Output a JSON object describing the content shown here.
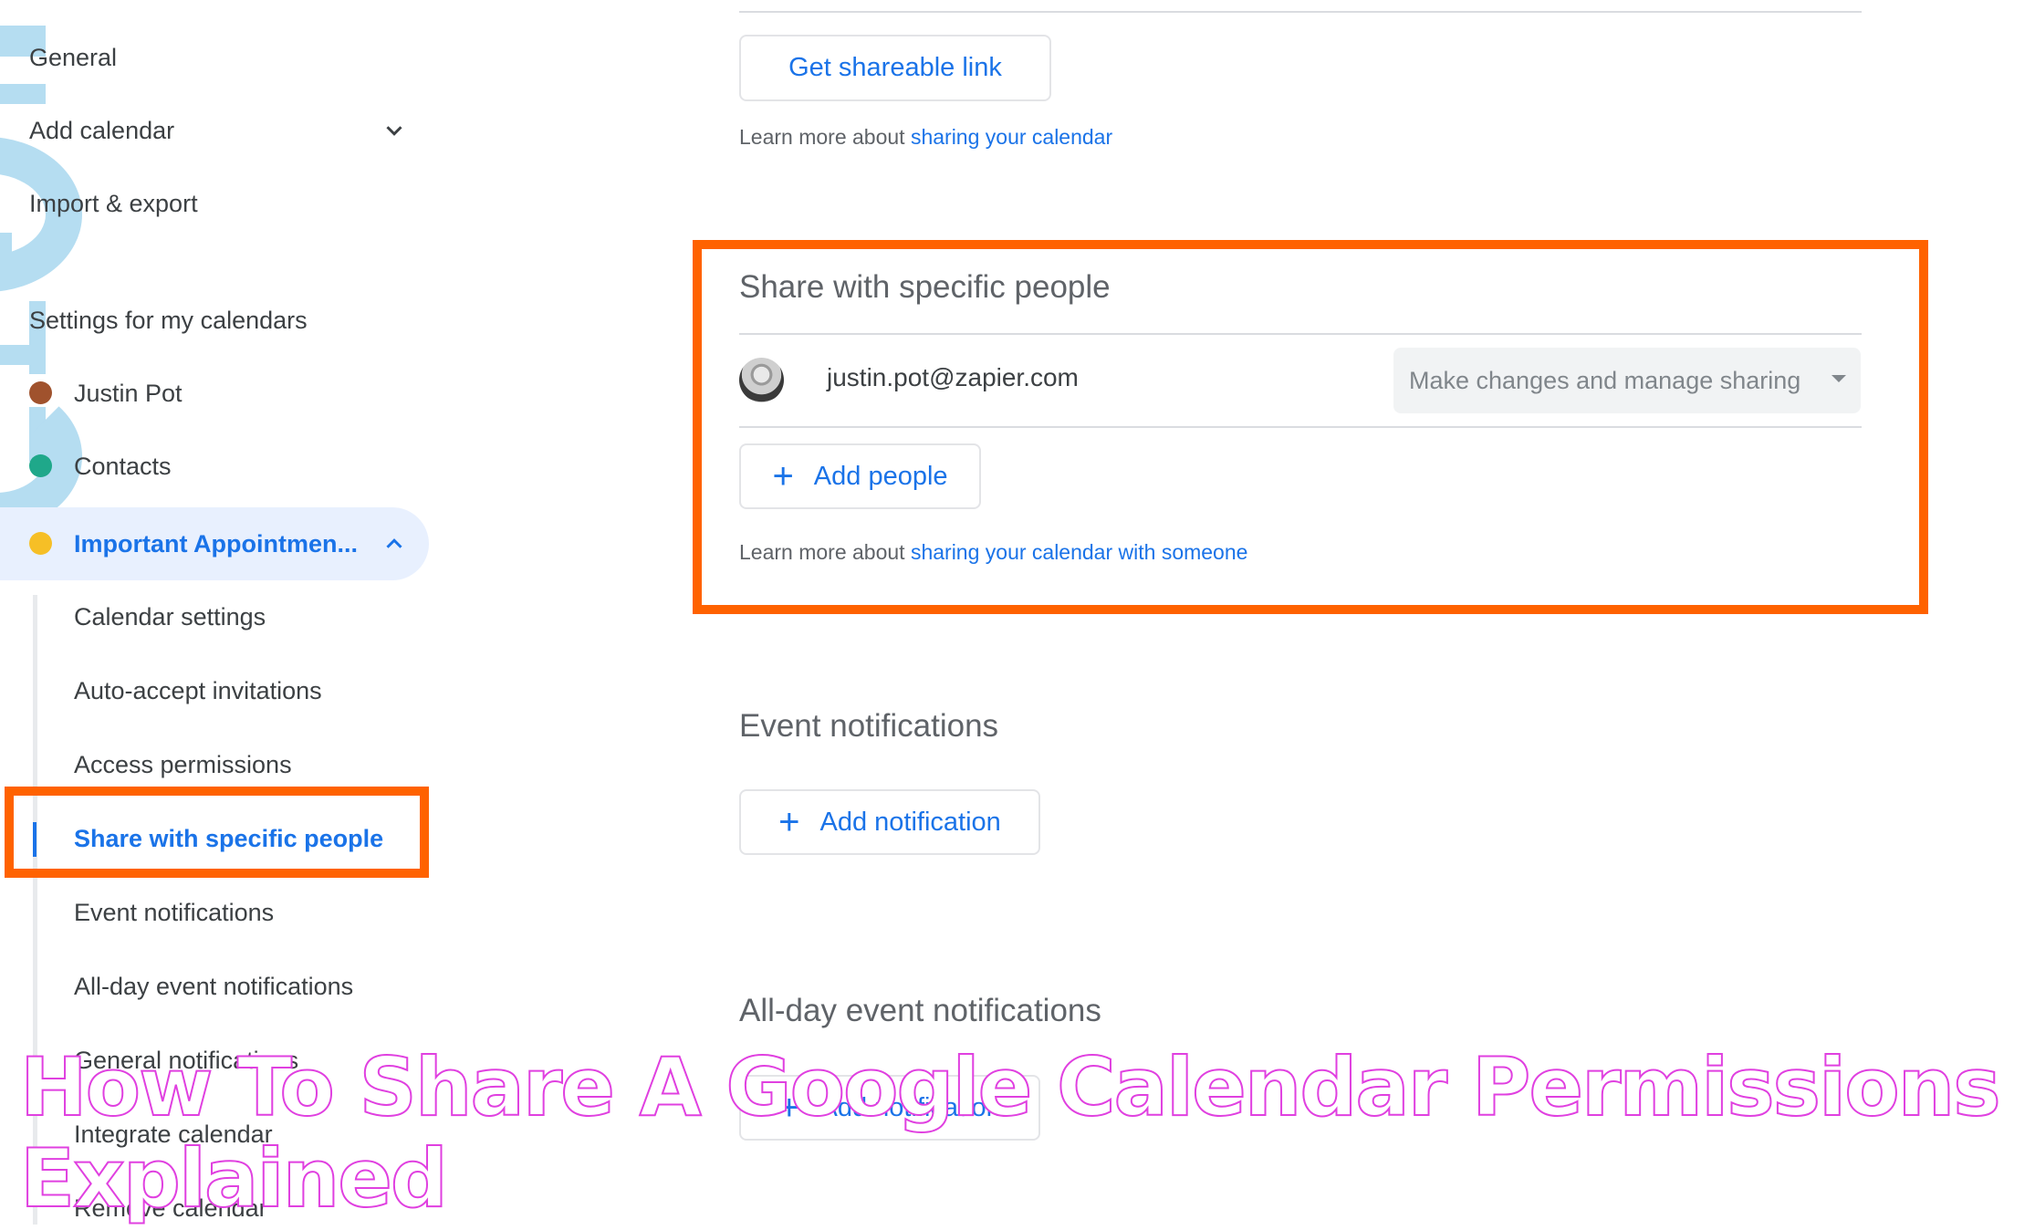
{
  "sidebar": {
    "top_items": [
      {
        "label": "General"
      },
      {
        "label": "Add calendar",
        "icon": "chevron-down-icon"
      },
      {
        "label": "Import & export"
      }
    ],
    "section_title": "Settings for my calendars",
    "calendars": [
      {
        "label": "Justin Pot",
        "color": "#a0522d"
      },
      {
        "label": "Contacts",
        "color": "#1fa88a"
      },
      {
        "label": "Important Appointmen...",
        "color": "#f6bf26",
        "expanded": true,
        "icon": "chevron-up-icon"
      }
    ],
    "sub_items": [
      {
        "label": "Calendar settings"
      },
      {
        "label": "Auto-accept invitations"
      },
      {
        "label": "Access permissions"
      },
      {
        "label": "Share with specific people",
        "active": true
      },
      {
        "label": "Event notifications"
      },
      {
        "label": "All-day event notifications"
      },
      {
        "label": "General notifications"
      },
      {
        "label": "Integrate calendar"
      },
      {
        "label": "Remove calendar"
      }
    ]
  },
  "main": {
    "access": {
      "share_link_button": "Get shareable link",
      "learn_prefix": "Learn more about ",
      "learn_link": "sharing your calendar"
    },
    "share_people": {
      "title": "Share with specific people",
      "people": [
        {
          "email": "justin.pot@zapier.com",
          "permission": "Make changes and manage sharing"
        }
      ],
      "add_button": "Add people",
      "learn_prefix": "Learn more about ",
      "learn_link": "sharing your calendar with someone"
    },
    "event_notifications": {
      "title": "Event notifications",
      "add_button": "Add notification"
    },
    "allday_notifications": {
      "title": "All-day event notifications",
      "add_button": "Add notification"
    }
  },
  "overlay": {
    "line1": "How To Share A Google Calendar Permissions",
    "line2": "Explained"
  },
  "colors": {
    "accent": "#1a73e8",
    "highlight_annotation": "#ff6200",
    "overlay_stroke": "#e040e0"
  }
}
